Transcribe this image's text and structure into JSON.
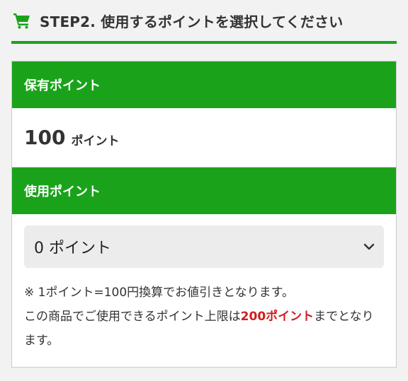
{
  "step": {
    "title": "STEP2. 使用するポイントを選択してください",
    "icon": "shopping-cart-icon"
  },
  "held_points": {
    "heading": "保有ポイント",
    "value": "100",
    "unit": "ポイント"
  },
  "use_points": {
    "heading": "使用ポイント",
    "selected": "0 ポイント"
  },
  "notes": {
    "line1": "※ 1ポイント=100円換算でお値引きとなります。",
    "line2_before": "この商品でご使用できるポイント上限は",
    "line2_limit": "200ポイント",
    "line2_after": "までとなります。"
  },
  "colors": {
    "accent": "#1aa31a",
    "limit_red": "#cc1f1f"
  }
}
